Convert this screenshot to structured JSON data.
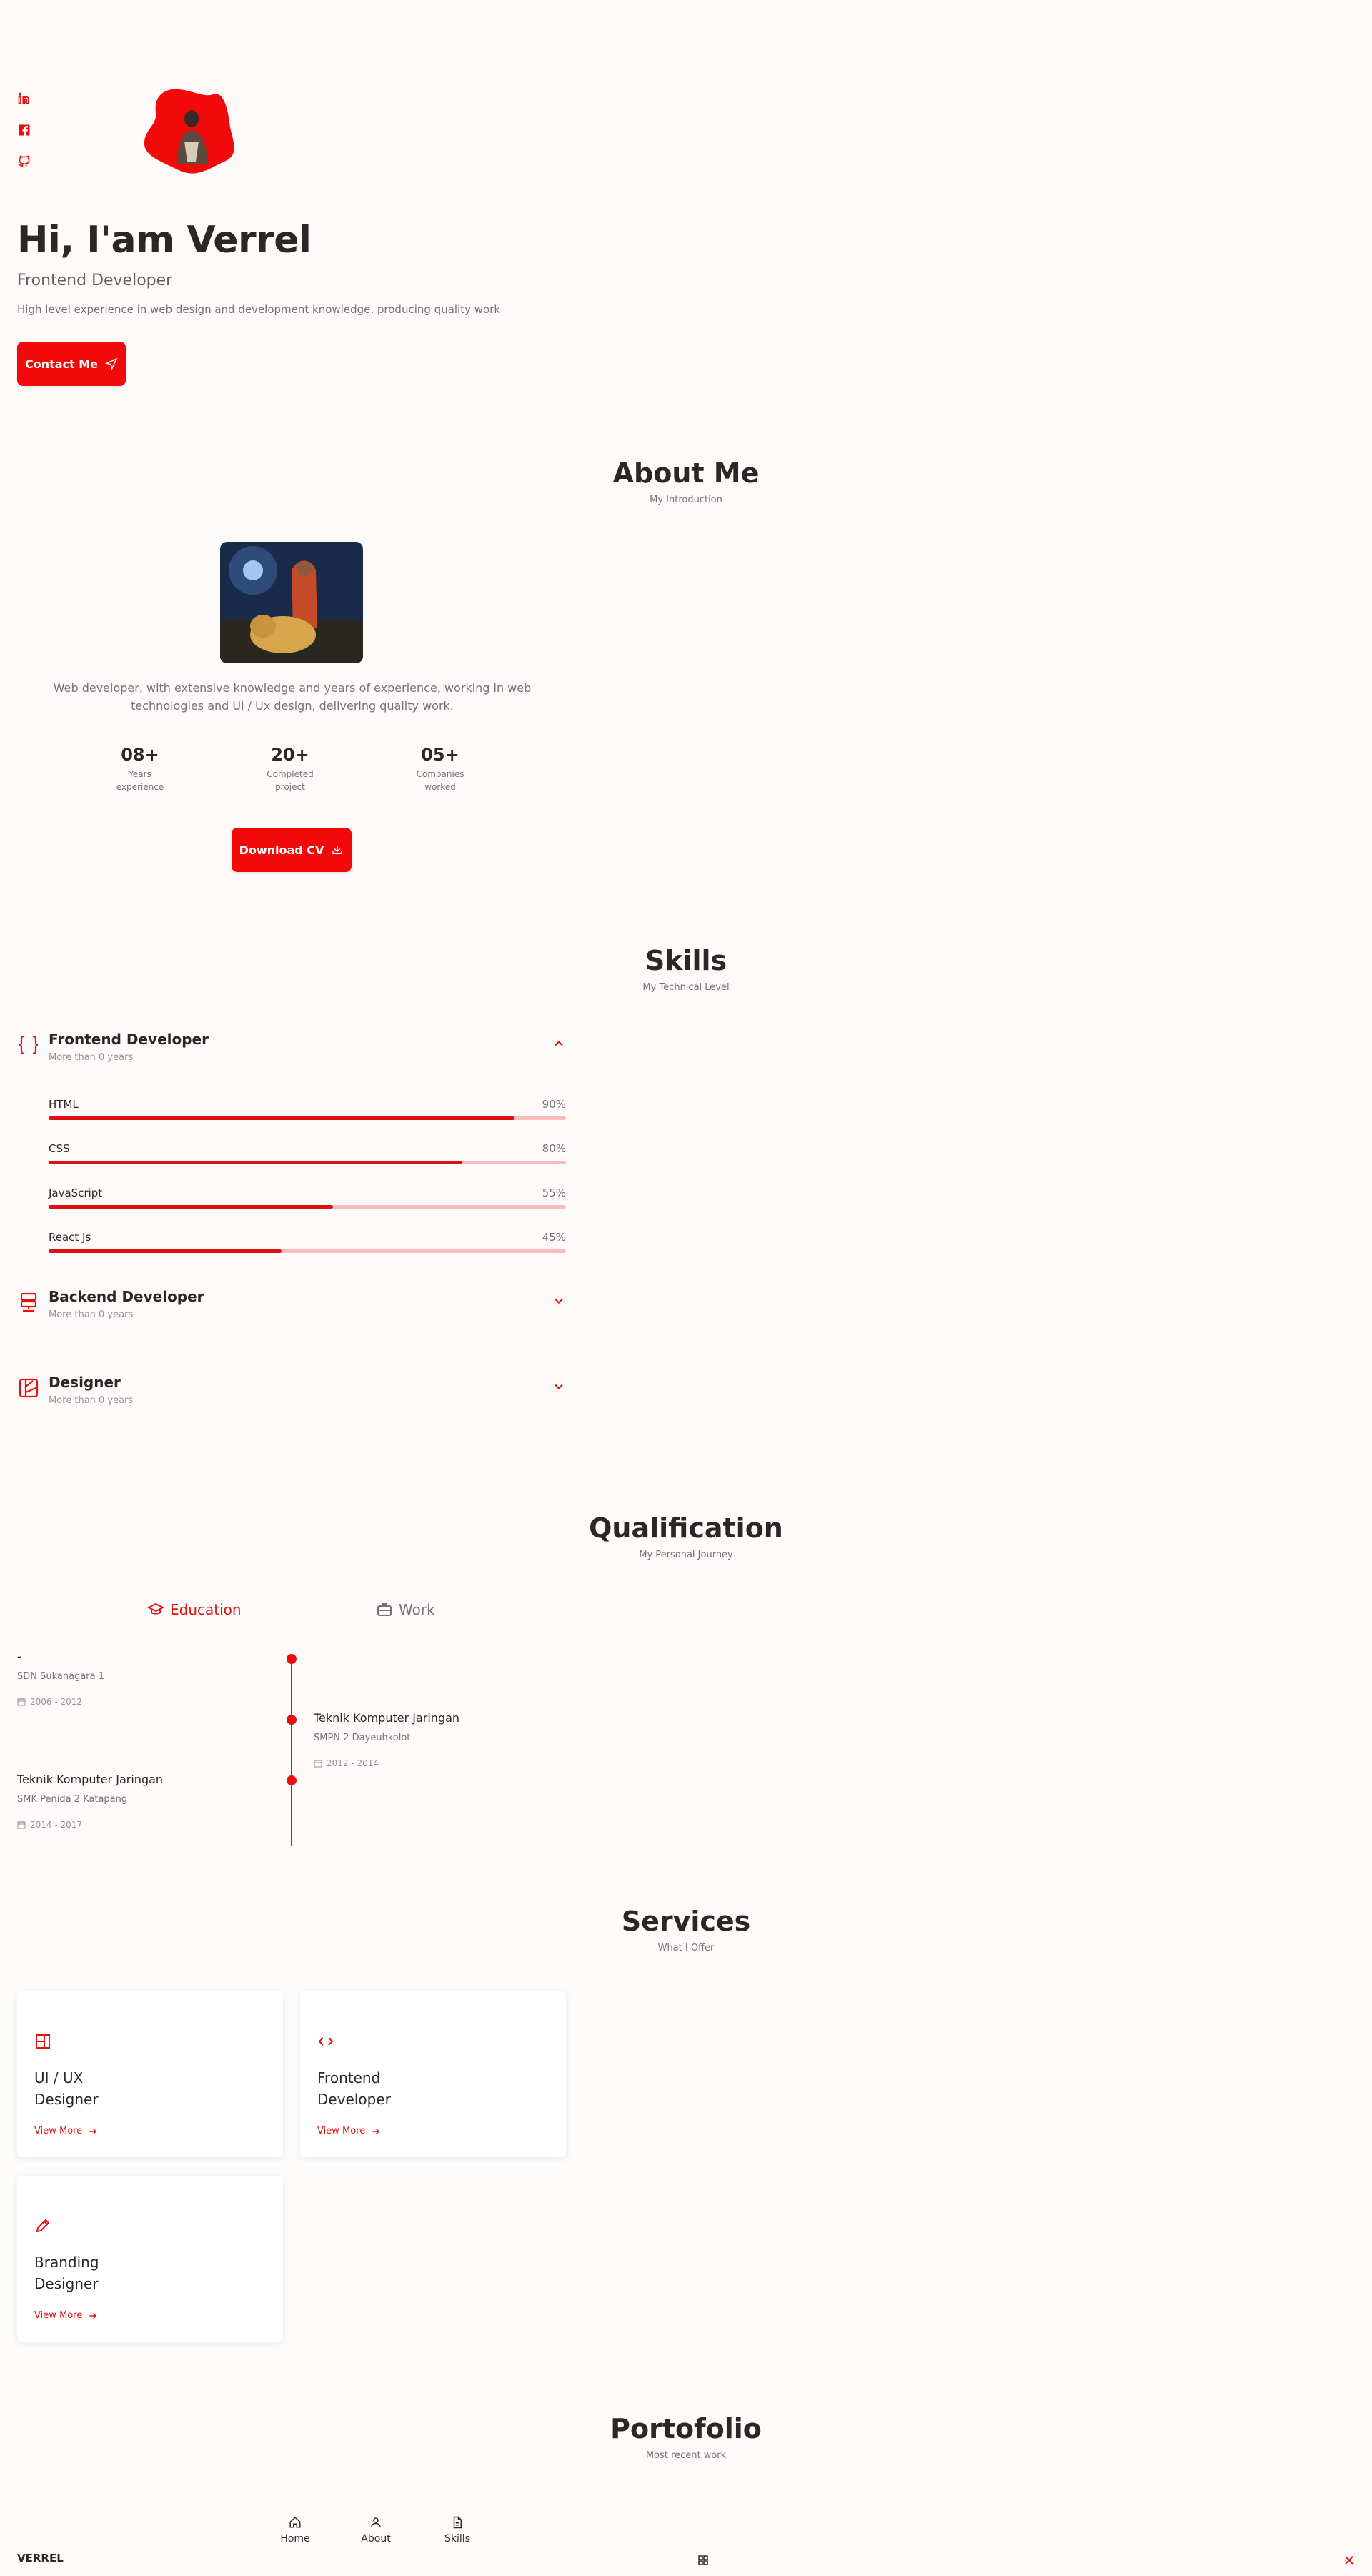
{
  "hero": {
    "title": "Hi, I'am Verrel",
    "subtitle": "Frontend Developer",
    "description": "High level experience in web design and development knowledge, producing quality work",
    "contact_button": "Contact Me"
  },
  "social": [
    "linkedin-icon",
    "facebook-icon",
    "github-icon"
  ],
  "about": {
    "title": "About Me",
    "subtitle": "My Introduction",
    "description": "Web developer, with extensive knowledge and years of experience, working in web technologies and Ui / Ux design, delivering quality work.",
    "stats": [
      {
        "num": "08+",
        "label1": "Years",
        "label2": "experience"
      },
      {
        "num": "20+",
        "label1": "Completed",
        "label2": "project"
      },
      {
        "num": "05+",
        "label1": "Companies",
        "label2": "worked"
      }
    ],
    "download_button": "Download CV"
  },
  "skills": {
    "title": "Skills",
    "subtitle": "My Technical Level",
    "groups": [
      {
        "title": "Frontend Developer",
        "subtitle": "More than 0 years",
        "items": [
          {
            "name": "HTML",
            "pct": "90%",
            "value": 90
          },
          {
            "name": "CSS",
            "pct": "80%",
            "value": 80
          },
          {
            "name": "JavaScript",
            "pct": "55%",
            "value": 55
          },
          {
            "name": "React Js",
            "pct": "45%",
            "value": 45
          }
        ]
      },
      {
        "title": "Backend Developer",
        "subtitle": "More than 0 years"
      },
      {
        "title": "Designer",
        "subtitle": "More than 0 years"
      }
    ]
  },
  "qualification": {
    "title": "Qualification",
    "subtitle": "My Personal Journey",
    "tabs": {
      "education": "Education",
      "work": "Work"
    },
    "entries": [
      {
        "title": "-",
        "sub": "SDN Sukanagara 1",
        "date": "2006 - 2012"
      },
      {
        "title": "Teknik Komputer Jaringan",
        "sub": "SMPN 2 Dayeuhkolot",
        "date": "2012 - 2014"
      },
      {
        "title": "Teknik Komputer Jaringan",
        "sub": "SMK Penida 2 Katapang",
        "date": "2014 - 2017"
      }
    ]
  },
  "services": {
    "title": "Services",
    "subtitle": "What I Offer",
    "cards": [
      {
        "line1": "UI / UX",
        "line2": "Designer",
        "link": "View More"
      },
      {
        "line1": "Frontend",
        "line2": "Developer",
        "link": "View More"
      },
      {
        "line1": "Branding",
        "line2": "Designer",
        "link": "View More"
      }
    ]
  },
  "portfolio": {
    "title": "Portofolio",
    "subtitle": "Most recent work"
  },
  "nav": {
    "logo": "VERREL",
    "items": [
      "Home",
      "About",
      "Skills"
    ]
  },
  "colors": {
    "accent": "#e8100f",
    "background": "#fcfbfa"
  }
}
